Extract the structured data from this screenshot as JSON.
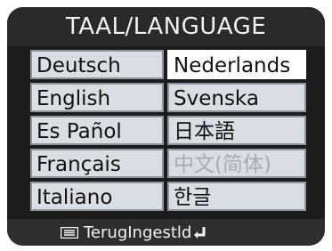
{
  "header": {
    "title": "TAAL/LANGUAGE"
  },
  "languages": {
    "left": [
      {
        "label": "Deutsch"
      },
      {
        "label": "English"
      },
      {
        "label": "Es Pañol"
      },
      {
        "label": "Français"
      },
      {
        "label": "Italiano"
      }
    ],
    "right": [
      {
        "label": "Nederlands",
        "selected": true
      },
      {
        "label": "Svenska"
      },
      {
        "label": "日本語"
      },
      {
        "label": "中文(简体)",
        "dimmed": true
      },
      {
        "label": "한글"
      }
    ]
  },
  "footer": {
    "back_label": "Terug",
    "set_label": "Ingestld",
    "menu_icon": "menu-icon",
    "enter_icon": "enter-icon"
  },
  "colors": {
    "screen_bg": "#1c1c1c",
    "cell_bg": "#d9dde4",
    "selected_bg": "#ffffff",
    "text": "#111111"
  }
}
